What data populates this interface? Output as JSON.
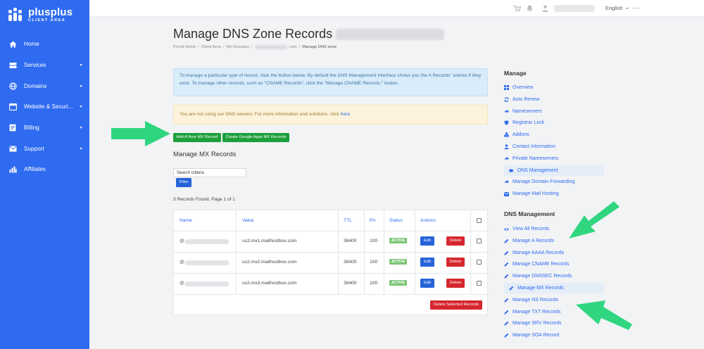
{
  "brand": {
    "name": "plusplus",
    "subtitle": "CLIENT AREA"
  },
  "sidebar": {
    "items": [
      {
        "label": "Home",
        "icon": "home-icon",
        "caret": false
      },
      {
        "label": "Services",
        "icon": "server-icon",
        "caret": true
      },
      {
        "label": "Domains",
        "icon": "globe-icon",
        "caret": true
      },
      {
        "label": "Website & Securi...",
        "icon": "browser-icon",
        "caret": true
      },
      {
        "label": "Billing",
        "icon": "billing-icon",
        "caret": true
      },
      {
        "label": "Support",
        "icon": "envelope-icon",
        "caret": true
      },
      {
        "label": "Affiliates",
        "icon": "chart-icon",
        "caret": false
      }
    ]
  },
  "topbar": {
    "language": "English"
  },
  "page": {
    "title": "Manage DNS Zone Records",
    "breadcrumb": [
      "Portal Home",
      "Client Area",
      "My Domains",
      "com",
      "Manage DNS zone"
    ]
  },
  "alerts": {
    "info": "To manage a particular type of record, click the button below. By default the DNS Management Interface shows you the A Records\" entries if they exist. To manage other records, such as \"CNAME Records\", click the \"Manage CNAME Records.\" button.",
    "warning": "You are not using our DNS servers. For more information and solutions, click",
    "warning_link": "here"
  },
  "buttons": {
    "add_mx": "Add A New MX Record",
    "google_mx": "Create Google Apps MX Records",
    "filter": "Filter",
    "delete_selected": "Delete Selected Records"
  },
  "mx": {
    "heading": "Manage MX Records",
    "search_placeholder": "Search criteria",
    "found": "3 Records Found, Page 1 of 1",
    "columns": [
      "Name",
      "Value",
      "TTL",
      "Pri",
      "Status",
      "Actions"
    ],
    "rows": [
      {
        "name_prefix": "@.",
        "value": "us2.mx1.mailhostbox.com",
        "ttl": "38400",
        "pri": "100",
        "status": "ACTIVE",
        "edit": "Edit",
        "delete": "Delete"
      },
      {
        "name_prefix": "@.",
        "value": "us2.mx2.mailhostbox.com",
        "ttl": "38400",
        "pri": "100",
        "status": "ACTIVE",
        "edit": "Edit",
        "delete": "Delete"
      },
      {
        "name_prefix": "@.",
        "value": "us2.mx3.mailhostbox.com",
        "ttl": "38400",
        "pri": "100",
        "status": "ACTIVE",
        "edit": "Edit",
        "delete": "Delete"
      }
    ]
  },
  "manage": {
    "heading": "Manage",
    "items": [
      {
        "label": "Overview",
        "icon": "grid-icon"
      },
      {
        "label": "Auto Renew",
        "icon": "sync-icon"
      },
      {
        "label": "Nameservers",
        "icon": "arrow-right-icon"
      },
      {
        "label": "Registrar Lock",
        "icon": "shield-icon"
      },
      {
        "label": "Addons",
        "icon": "cubes-icon"
      },
      {
        "label": "Contact Information",
        "icon": "user-icon"
      },
      {
        "label": "Private Nameservers",
        "icon": "arrow-right-icon"
      },
      {
        "label": "DNS Management",
        "icon": "tag-icon",
        "active": true
      },
      {
        "label": "Manage Domain Forwarding",
        "icon": "arrow-right-icon"
      },
      {
        "label": "Manage Mail Hosting",
        "icon": "envelope-icon"
      }
    ]
  },
  "dns": {
    "heading": "DNS Management",
    "items": [
      {
        "label": "View All Records",
        "icon": "eye-icon"
      },
      {
        "label": "Manage A Records",
        "icon": "pencil-icon"
      },
      {
        "label": "Manage AAAA Records",
        "icon": "pencil-icon"
      },
      {
        "label": "Manage CNAME Records",
        "icon": "pencil-icon"
      },
      {
        "label": "Manage DNSSEC Records",
        "icon": "pencil-icon"
      },
      {
        "label": "Manage MX Records",
        "icon": "pencil-icon",
        "active": true
      },
      {
        "label": "Manage NS Records",
        "icon": "pencil-icon"
      },
      {
        "label": "Manage TXT Records",
        "icon": "pencil-icon"
      },
      {
        "label": "Manage SRV Records",
        "icon": "pencil-icon"
      },
      {
        "label": "Manage SOA Record",
        "icon": "pencil-icon"
      }
    ]
  },
  "colors": {
    "primary": "#2f6bf0",
    "green": "#1d9f3b",
    "red": "#d6262e",
    "arrow": "#2fd67f"
  }
}
